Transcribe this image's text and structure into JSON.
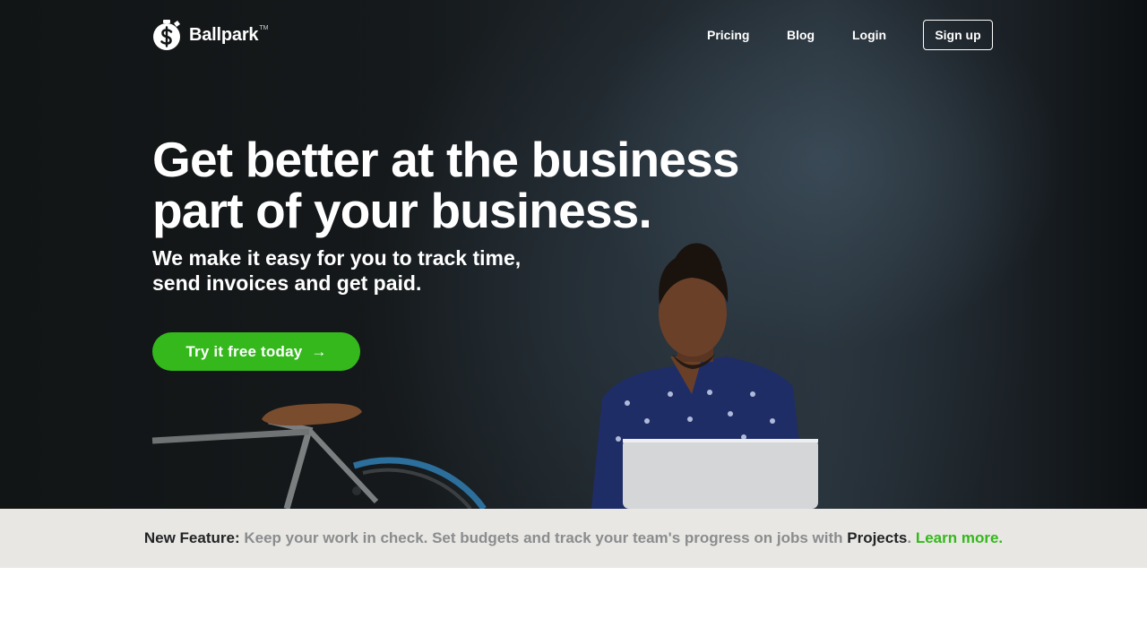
{
  "brand": {
    "name": "Ballpark",
    "trademark": "TM",
    "logo_icon": "dollar-stopwatch-icon"
  },
  "nav": {
    "items": [
      {
        "label": "Pricing"
      },
      {
        "label": "Blog"
      },
      {
        "label": "Login"
      }
    ],
    "signup_label": "Sign up"
  },
  "hero": {
    "headline_line1": "Get better at the business",
    "headline_line2": "part of your business.",
    "subhead_line1": "We make it easy for you to track time,",
    "subhead_line2": "send invoices and get paid.",
    "cta_label": "Try it free today",
    "cta_icon": "arrow-right-icon"
  },
  "banner": {
    "lead": "New Feature:",
    "text": "Keep your work in check. Set budgets and track your team's progress on jobs with",
    "highlight": "Projects",
    "period": ".",
    "link": "Learn more."
  },
  "colors": {
    "accent_green": "#34b81c",
    "banner_background": "#e8e7e3",
    "hero_dark": "#121516"
  }
}
